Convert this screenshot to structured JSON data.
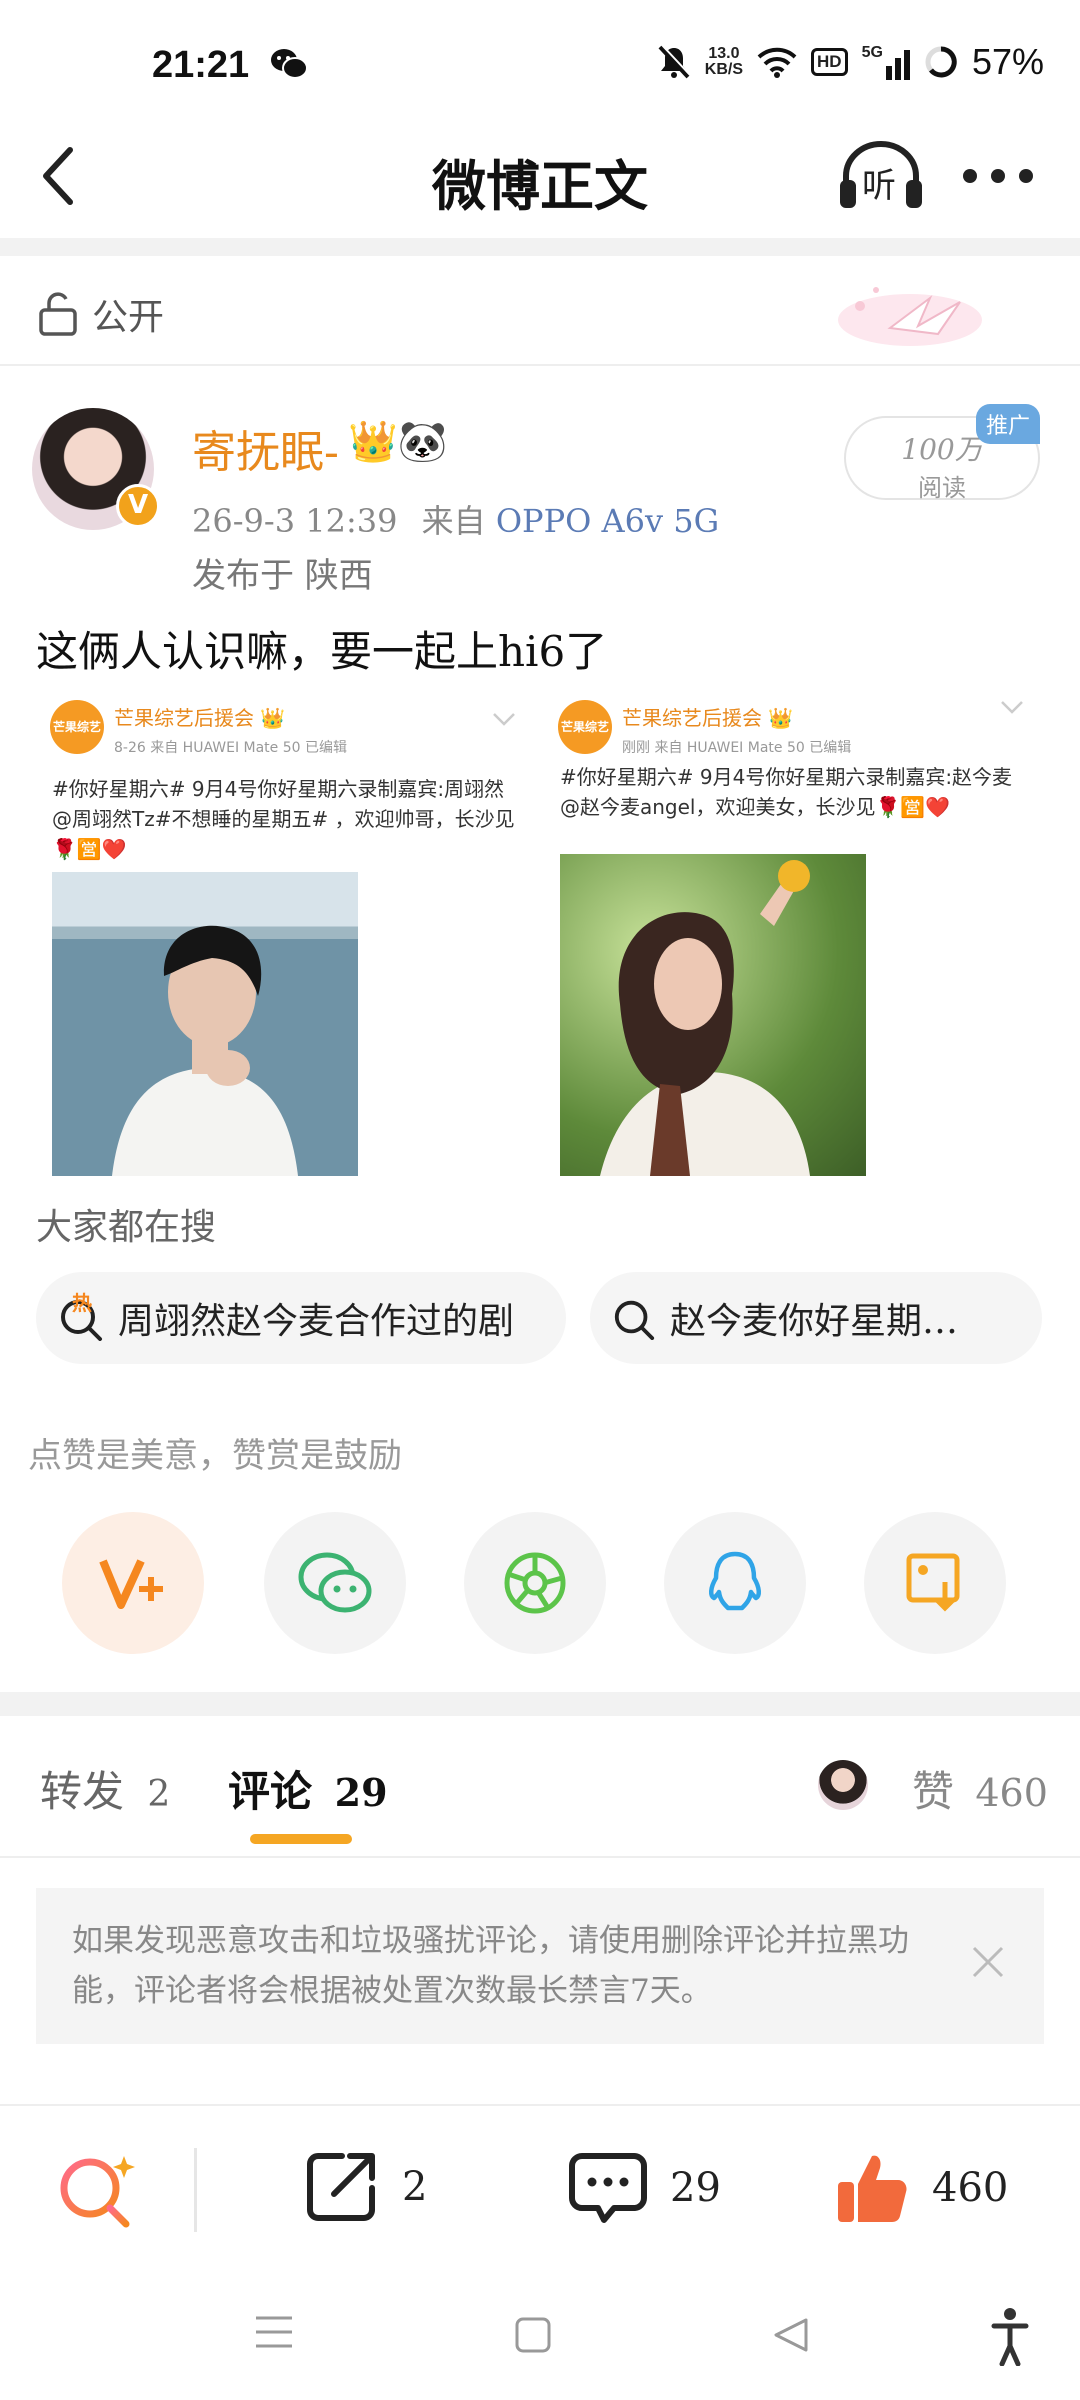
{
  "status_bar": {
    "time": "21:21",
    "net_speed_value": "13.0",
    "net_speed_unit": "KB/S",
    "hd": "HD",
    "signal": "5G",
    "battery": "57%",
    "icons": [
      "wechat-icon",
      "mute-icon",
      "wifi-icon",
      "signal-icon",
      "battery-icon"
    ]
  },
  "nav": {
    "title": "微博正文",
    "listen_label": "听"
  },
  "visibility": {
    "label": "公开"
  },
  "post": {
    "author": "寄抚眠-",
    "author_badges": "👑🐼",
    "verified_mark": "V",
    "meta_date": "26-9-3 12:39",
    "meta_from": "来自",
    "meta_device": "OPPO A6v 5G",
    "location": "发布于 陕西",
    "reads_count": "100万",
    "reads_label": "阅读",
    "promo_badge": "推广",
    "text": "这俩人认识嘛，要一起上hi6了"
  },
  "embeds": [
    {
      "logo": "芒果综艺",
      "name": "芒果综艺后援会",
      "crown": "👑",
      "meta": "8-26  来自 HUAWEI Mate 50  已编辑",
      "text": "#你好星期六# 9月4号你好星期六录制嘉宾:周翊然@周翊然Tz#不想睡的星期五# ，欢迎帅哥，长沙见🌹🈺❤️"
    },
    {
      "logo": "芒果综艺",
      "name": "芒果综艺后援会",
      "crown": "👑",
      "meta": "刚刚  来自 HUAWEI Mate 50  已编辑",
      "text": "#你好星期六# 9月4号你好星期六录制嘉宾:赵今麦@赵今麦angel，欢迎美女，长沙见🌹🈺❤️"
    }
  ],
  "search": {
    "heading": "大家都在搜",
    "hot_badge": "热",
    "pills": [
      "周翊然赵今麦合作过的剧",
      "赵今麦你好星期…"
    ]
  },
  "praise_line": "点赞是美意，赞赏是鼓励",
  "share_icons": [
    "reward-v-icon",
    "wechat-share-icon",
    "moments-icon",
    "qq-icon",
    "save-image-icon"
  ],
  "tabs": {
    "repost_label": "转发",
    "repost_count": "2",
    "comment_label": "评论",
    "comment_count": "29",
    "like_label": "赞",
    "like_count": "460"
  },
  "notice": "如果发现恶意攻击和垃圾骚扰评论，请使用删除评论并拉黑功能，评论者将会根据被处置次数最长禁言7天。",
  "actions": {
    "repost_count": "2",
    "comment_count": "29",
    "like_count": "460"
  },
  "colors": {
    "accent": "#e8891d",
    "underline": "#f5a623",
    "like": "#f26a3c"
  }
}
